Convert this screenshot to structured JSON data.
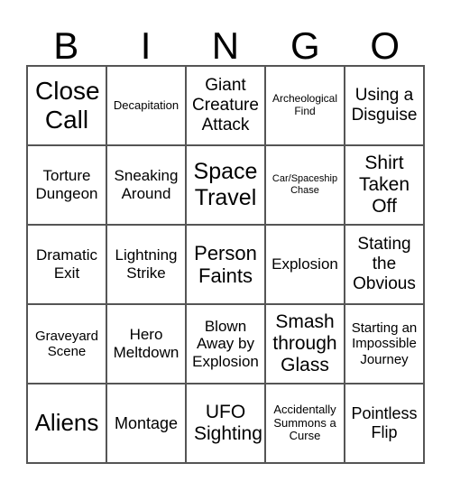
{
  "header": [
    "B",
    "I",
    "N",
    "G",
    "O"
  ],
  "cells": [
    "Close Call",
    "Decapitation",
    "Giant Creature Attack",
    "Archeological Find",
    "Using a Disguise",
    "Torture Dungeon",
    "Sneaking Around",
    "Space Travel",
    "Car/Spaceship Chase",
    "Shirt Taken Off",
    "Dramatic Exit",
    "Lightning Strike",
    "Person Faints",
    "Explosion",
    "Stating the Obvious",
    "Graveyard Scene",
    "Hero Meltdown",
    "Blown Away by Explosion",
    "Smash through Glass",
    "Starting an Impossible Journey",
    "Aliens",
    "Montage",
    "UFO Sighting",
    "Accidentally Summons a Curse",
    "Pointless Flip"
  ]
}
